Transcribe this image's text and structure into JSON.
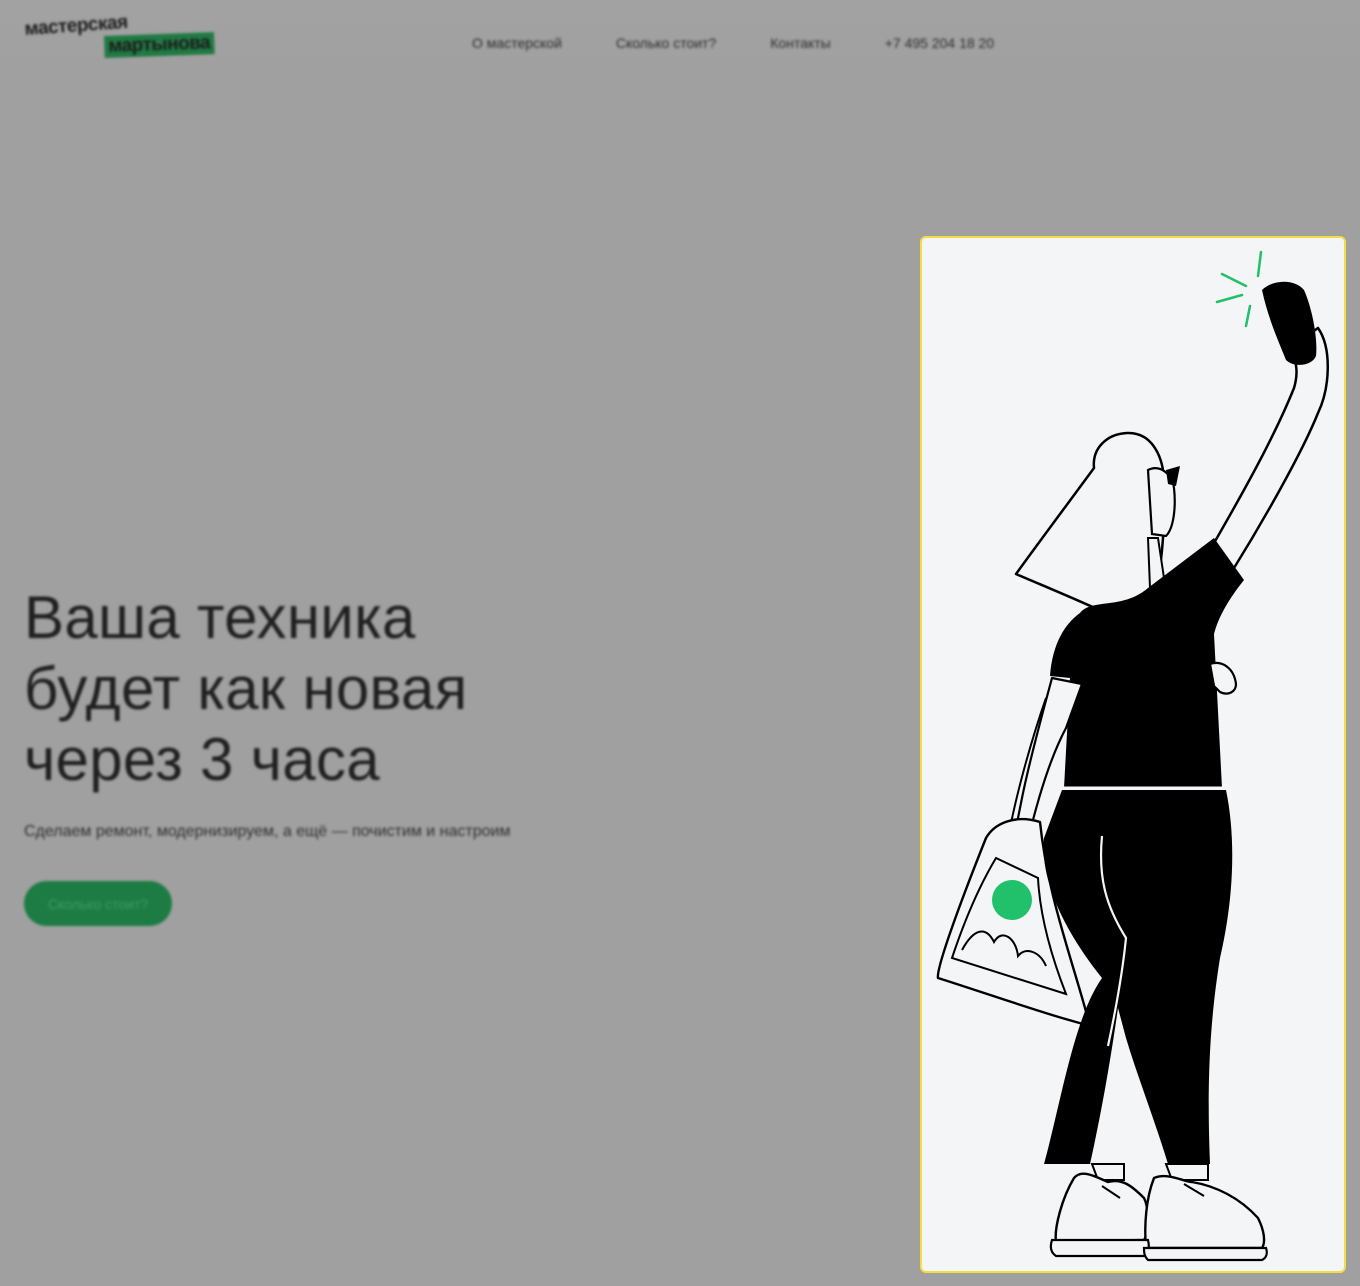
{
  "logo": {
    "line1": "мастерская",
    "line2": "мартынова"
  },
  "nav": {
    "items": [
      {
        "id": "about",
        "label": "О мастерской"
      },
      {
        "id": "price",
        "label": "Сколько стоит?"
      },
      {
        "id": "contacts",
        "label": "Контакты"
      },
      {
        "id": "phone",
        "label": "+7 495 204 18 20"
      }
    ]
  },
  "hero": {
    "title_lines": [
      "Ваша техника",
      "будет как новая",
      "через 3 часа"
    ],
    "subtitle": "Сделаем ремонт, модернизируем, а ещё — почистим и настроим",
    "cta_label": "Сколько стоит?"
  },
  "colors": {
    "overlay": "#a0a0a0",
    "accent": "#21c06a",
    "highlight_border": "#f3dd45",
    "card_bg": "#f4f5f7"
  },
  "icons": {
    "illustration": "woman-taking-selfie-illustration"
  }
}
